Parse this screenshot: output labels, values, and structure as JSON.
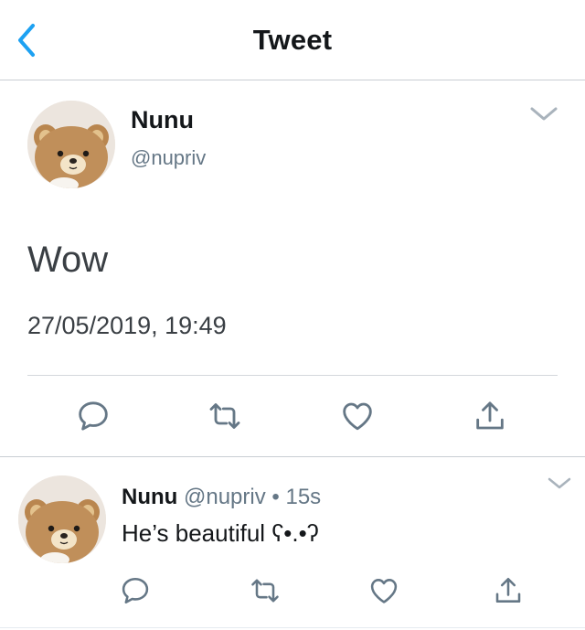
{
  "header": {
    "title": "Tweet",
    "back_icon": "chevron-left-icon"
  },
  "colors": {
    "accent": "#1da1f2",
    "secondary_text": "#657786",
    "icon": "#657786",
    "divider": "#c9ced3"
  },
  "tweet": {
    "author_name": "Nunu",
    "author_handle": "@nupriv",
    "text": "Wow",
    "timestamp": "27/05/2019, 19:49",
    "actions": [
      "reply-icon",
      "retweet-icon",
      "like-icon",
      "share-icon"
    ]
  },
  "reply": {
    "author_name": "Nunu",
    "author_handle": "@nupriv",
    "separator": "•",
    "time": "15s",
    "text": "He’s beautiful  ʕ•.•ʔ",
    "actions": [
      "reply-icon",
      "retweet-icon",
      "like-icon",
      "share-icon"
    ]
  }
}
